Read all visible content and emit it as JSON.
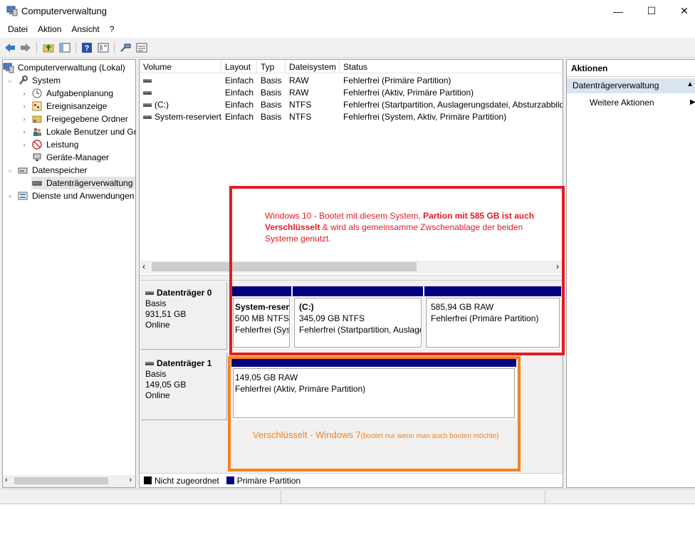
{
  "window": {
    "title": "Computerverwaltung",
    "controls": [
      "—",
      "☐",
      "✕"
    ]
  },
  "menu": [
    "Datei",
    "Aktion",
    "Ansicht",
    "?"
  ],
  "tree": {
    "items": [
      {
        "label": "Computerverwaltung (Lokal)",
        "icon": "computer-management-icon",
        "expander": ""
      },
      {
        "label": "System",
        "icon": "system-tools-icon",
        "expander": "⌵"
      },
      {
        "label": "Aufgabenplanung",
        "icon": "task-scheduler-icon",
        "expander": "›"
      },
      {
        "label": "Ereignisanzeige",
        "icon": "event-viewer-icon",
        "expander": "›"
      },
      {
        "label": "Freigegebene Ordner",
        "icon": "shared-folder-icon",
        "expander": "›"
      },
      {
        "label": "Lokale Benutzer und Gru",
        "icon": "users-icon",
        "expander": "›"
      },
      {
        "label": "Leistung",
        "icon": "performance-icon",
        "expander": "›"
      },
      {
        "label": "Geräte-Manager",
        "icon": "device-manager-icon",
        "expander": ""
      },
      {
        "label": "Datenspeicher",
        "icon": "storage-icon",
        "expander": "⌵"
      },
      {
        "label": "Datenträgerverwaltung",
        "icon": "disk-management-icon",
        "expander": ""
      },
      {
        "label": "Dienste und Anwendungen",
        "icon": "services-icon",
        "expander": "›"
      }
    ]
  },
  "volumes": {
    "columns": [
      "Volume",
      "Layout",
      "Typ",
      "Dateisystem",
      "Status"
    ],
    "rows": [
      {
        "volume": "",
        "layout": "Einfach",
        "type": "Basis",
        "fs": "RAW",
        "status": "Fehlerfrei (Primäre Partition)"
      },
      {
        "volume": "",
        "layout": "Einfach",
        "type": "Basis",
        "fs": "RAW",
        "status": "Fehlerfrei (Aktiv, Primäre Partition)"
      },
      {
        "volume": "(C:)",
        "layout": "Einfach",
        "type": "Basis",
        "fs": "NTFS",
        "status": "Fehlerfrei (Startpartition, Auslagerungsdatei, Absturzabbild"
      },
      {
        "volume": "System-reserviert",
        "layout": "Einfach",
        "type": "Basis",
        "fs": "NTFS",
        "status": "Fehlerfrei (System, Aktiv, Primäre Partition)"
      }
    ]
  },
  "disks": [
    {
      "name": "Datenträger 0",
      "type": "Basis",
      "size": "931,51 GB",
      "state": "Online",
      "partitions": [
        {
          "name": "System-reser",
          "size": "500 MB NTFS",
          "status": "Fehlerfrei (Sys"
        },
        {
          "name": "(C:)",
          "size": "345,09 GB NTFS",
          "status": "Fehlerfrei (Startpartition, Auslage"
        },
        {
          "name": "",
          "size": "585,94 GB RAW",
          "status": "Fehlerfrei (Primäre Partition)"
        }
      ]
    },
    {
      "name": "Datenträger 1",
      "type": "Basis",
      "size": "149,05 GB",
      "state": "Online",
      "partitions": [
        {
          "name": "",
          "size": "149,05 GB RAW",
          "status": "Fehlerfrei (Aktiv, Primäre Partition)"
        }
      ]
    }
  ],
  "legend": {
    "unallocated": "Nicht zugeordnet",
    "primary": "Primäre Partition",
    "unallocated_color": "#000000",
    "primary_color": "#000080"
  },
  "actions": {
    "title": "Aktionen",
    "section": "Datenträgerverwaltung",
    "item": "Weitere Aktionen"
  },
  "annotations": {
    "red": {
      "part1": "Windows 10 - Bootet mit diesem System, ",
      "bold": "Partion mit 585 GB ist auch Verschlüsselt",
      "part2": " & wird als gemeinsamme Zwschenablage der beiden Systeme genutzt.",
      "color": "#e31b23"
    },
    "orange": {
      "main": "Verschlüsselt - Windows 7",
      "small": "(bootet nur wenn man auch booten möchte)",
      "color": "#f58220"
    }
  }
}
